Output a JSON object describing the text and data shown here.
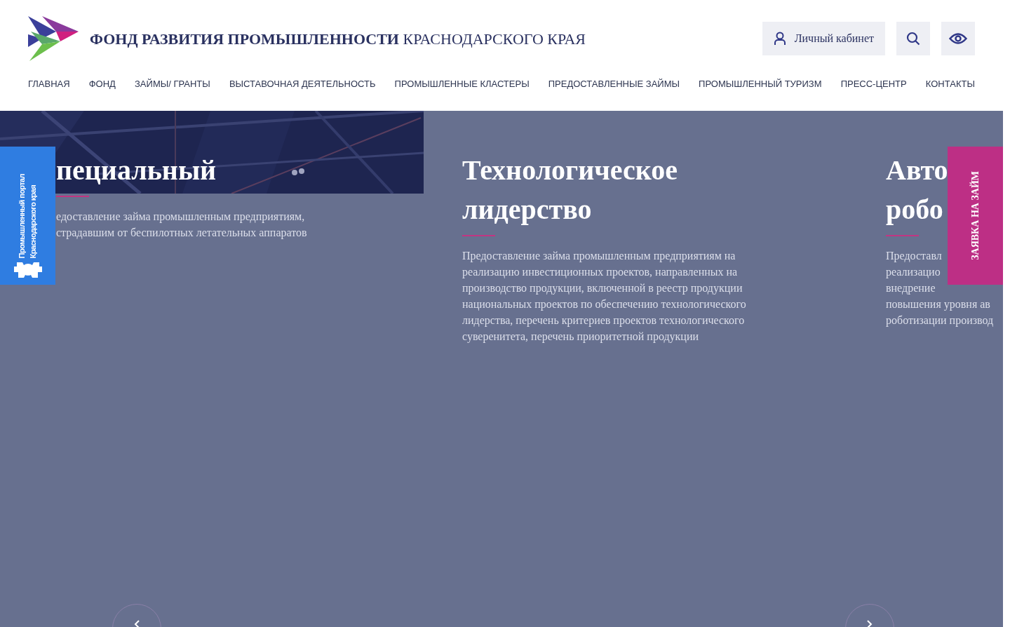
{
  "header": {
    "title": "**ФОНД РАЗВИТИЯ ПРОМЫШЛЕННОСТИ** КРАСНОДАРСКОГО КРАЯ",
    "account_button": "Личный кабинет"
  },
  "nav": [
    "ГЛАВНАЯ",
    "ФОНД",
    "ЗАЙМЫ/ ГРАНТЫ",
    "ВЫСТАВОЧНАЯ ДЕЯТЕЛЬНОСТЬ",
    "ПРОМЫШЛЕННЫЕ КЛАСТЕРЫ",
    "ПРЕДОСТАВЛЕННЫЕ ЗАЙМЫ",
    "ПРОМЫШЛЕННЫЙ ТУРИЗМ",
    "ПРЕСС-ЦЕНТР",
    "КОНТАКТЫ"
  ],
  "slides": [
    {
      "title_lines": [
        "пециальный"
      ],
      "description_lines": [
        "едоставление займа промышленным предприятиям,",
        "страдавшим от беспилотных летательных аппаратов"
      ]
    },
    {
      "title_lines": [
        "Технологическое",
        "лидерство"
      ],
      "description_lines": [
        "Предоставление займа промышленным предприятиям на",
        "реализацию инвестиционных проектов, направленных на",
        "производство продукции, включенной в реестр продукции",
        "национальных проектов по обеспечению технологического",
        "лидерства, перечень критериев проектов технологического",
        "суверенитета, перечень приоритетной продукции"
      ]
    },
    {
      "title_lines": [
        "Авто",
        "робо"
      ],
      "description_lines": [
        "Предоставл",
        "реализацио",
        "внедрение",
        "повышения уровня ав",
        "роботизации производ"
      ]
    }
  ],
  "side_tab": {
    "lines": [
      "Промышленный портал",
      "Краснодарского края"
    ]
  },
  "loan_tab": "ЗАЯВКА НА ЗАЙМ"
}
